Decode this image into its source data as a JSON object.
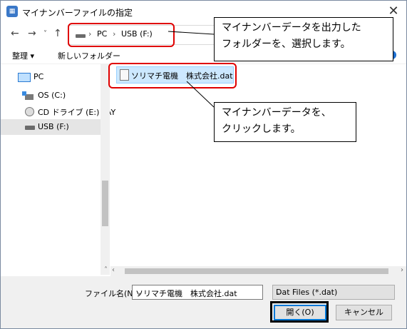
{
  "window": {
    "title": "マイナンバーファイルの指定",
    "close_glyph": "✕"
  },
  "nav": {
    "back": "←",
    "forward": "→",
    "recent": "˅",
    "up": "↑"
  },
  "address": {
    "crumbs": [
      "PC",
      "USB (F:)"
    ],
    "sep": "›"
  },
  "toolbar": {
    "organize": "整理 ▾",
    "new_folder": "新しいフォルダー"
  },
  "sidebar": {
    "items": [
      {
        "label": "PC"
      },
      {
        "label": "OS (C:)"
      },
      {
        "label": "CD ドライブ (E:) PAY"
      },
      {
        "label": "USB (F:)"
      }
    ]
  },
  "files": [
    {
      "name": "ソリマチ電機　株式会社.dat"
    }
  ],
  "scroll": {
    "up": "˄",
    "left": "‹",
    "right": "›"
  },
  "bottom": {
    "filename_label": "ファイル名(N):",
    "filename_value": "ソリマチ電機　株式会社.dat",
    "filter_value": "Dat Files (*.dat)",
    "open_label": "開く(O)",
    "cancel_label": "キャンセル",
    "chevron": "⌄"
  },
  "callouts": {
    "folder": [
      "マイナンバーデータを出力した",
      "フォルダーを、選択します。"
    ],
    "file": [
      "マイナンバーデータを、",
      "クリックします。"
    ]
  },
  "colors": {
    "accent": "#0078d7",
    "selection": "#cce8ff",
    "annotation_red": "#e00000"
  }
}
